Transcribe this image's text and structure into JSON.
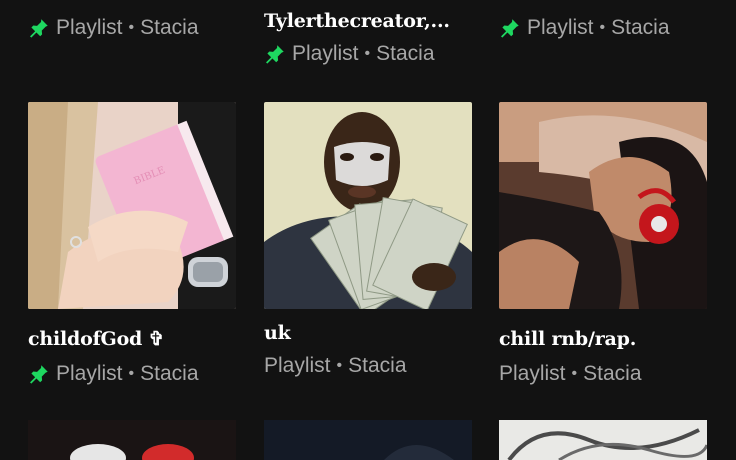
{
  "row_top": [
    {
      "title": "",
      "subtitle_type": "Playlist",
      "subtitle_owner": "Stacia",
      "pinned": true
    },
    {
      "title": "Tylerthecreator,...",
      "subtitle_type": "Playlist",
      "subtitle_owner": "Stacia",
      "pinned": true
    },
    {
      "title": "",
      "subtitle_type": "Playlist",
      "subtitle_owner": "Stacia",
      "pinned": true
    }
  ],
  "row_middle": [
    {
      "title": "childofGod ✞",
      "subtitle_type": "Playlist",
      "subtitle_owner": "Stacia",
      "pinned": true,
      "cover": "woman-holding-pink-bible"
    },
    {
      "title": "uk",
      "subtitle_type": "Playlist",
      "subtitle_owner": "Stacia",
      "pinned": false,
      "cover": "man-with-cash-fan"
    },
    {
      "title": "chill rnb/rap.",
      "subtitle_type": "Playlist",
      "subtitle_owner": "Stacia",
      "pinned": false,
      "cover": "woman-with-red-headphones"
    }
  ],
  "separator": "•",
  "colors": {
    "background": "#121212",
    "pin_green": "#1ed760",
    "subtext": "#a7a7a7"
  }
}
